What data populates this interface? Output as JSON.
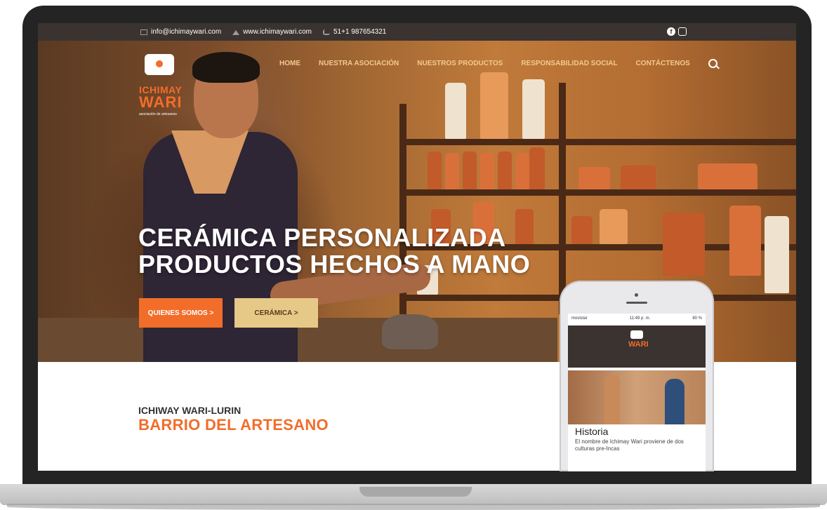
{
  "topbar": {
    "email": "info@ichimaywari.com",
    "website": "www.ichimaywari.com",
    "phone": "51+1 987654321",
    "social": [
      {
        "name": "facebook",
        "icon": "facebook-icon"
      },
      {
        "name": "instagram",
        "icon": "instagram-icon"
      }
    ]
  },
  "logo": {
    "line1": "ICHIMAY",
    "line2": "WARI",
    "line3": "asociación de artesanos"
  },
  "nav": {
    "items": [
      {
        "label": "HOME"
      },
      {
        "label": "NUESTRA ASOCIACIÓN"
      },
      {
        "label": "NUESTROS PRODUCTOS"
      },
      {
        "label": "RESPONSABILIDAD SOCIAL"
      },
      {
        "label": "CONTÁCTENOS"
      }
    ]
  },
  "hero": {
    "title_line1": "CERÁMICA PERSONALIZADA",
    "title_line2": "PRODUCTOS HECHOS A MANO",
    "button1": "QUIENES SOMOS >",
    "button2": "CERÁMICA >",
    "slides": 5,
    "active_slide": 2
  },
  "section": {
    "eyebrow": "ICHIWAY WARI-LURIN",
    "title": "BARRIO DEL ARTESANO"
  },
  "phone": {
    "carrier": "movistar",
    "time": "11:49 p. m.",
    "battery": "80 %",
    "logo_text": "WARI",
    "card_title": "Historia",
    "card_text": "El nombre de Ichimay Wari proviene de dos culturas pre-Incas"
  },
  "colors": {
    "accent": "#f26d2a",
    "gold": "#e7c987",
    "dark": "#3a3330"
  }
}
